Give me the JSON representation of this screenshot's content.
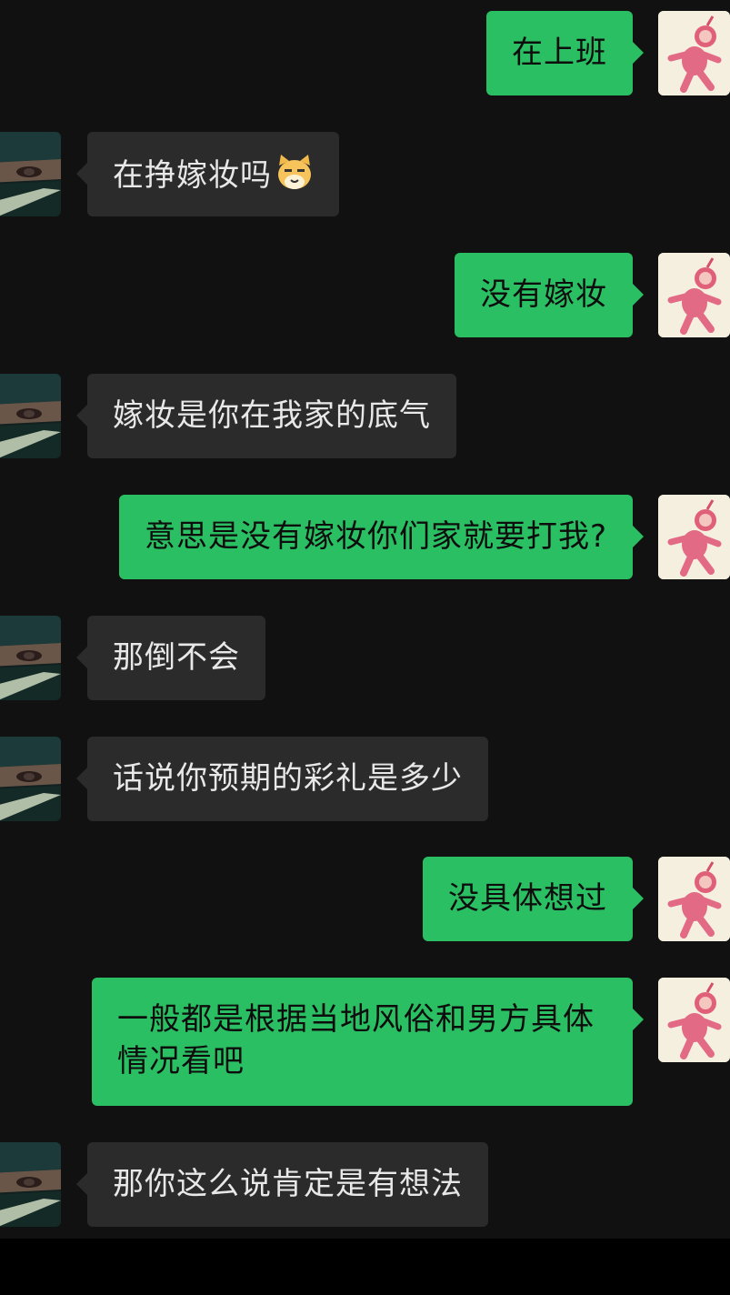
{
  "colors": {
    "background": "#111111",
    "incoming_bubble": "#2b2b2b",
    "outgoing_bubble": "#2bbf63",
    "incoming_text": "#e8e8e8",
    "outgoing_text": "#0d0d0d"
  },
  "messages": [
    {
      "side": "out",
      "text": "在上班"
    },
    {
      "side": "in",
      "text": "在挣嫁妆吗",
      "emoji": "cat-face-emoji"
    },
    {
      "side": "out",
      "text": "没有嫁妆"
    },
    {
      "side": "in",
      "text": "嫁妆是你在我家的底气"
    },
    {
      "side": "out",
      "text": "意思是没有嫁妆你们家就要打我?"
    },
    {
      "side": "in",
      "text": "那倒不会"
    },
    {
      "side": "in",
      "text": "话说你预期的彩礼是多少"
    },
    {
      "side": "out",
      "text": "没具体想过"
    },
    {
      "side": "out",
      "text": "一般都是根据当地风俗和男方具体情况看吧"
    },
    {
      "side": "in",
      "text": "那你这么说肯定是有想法"
    }
  ],
  "avatars": {
    "other": "masked-man-avatar",
    "self": "pink-doll-avatar"
  }
}
